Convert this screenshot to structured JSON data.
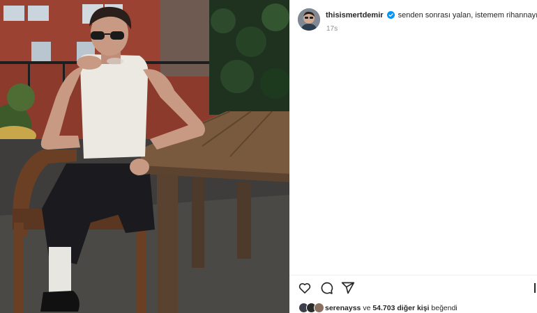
{
  "post": {
    "username": "thisismertdemir",
    "verified": true,
    "caption": "senden sonrası yalan, istemem rihannayı bile.",
    "time": "17s"
  },
  "actions": {
    "like_icon": "heart-icon",
    "comment_icon": "comment-icon",
    "share_icon": "share-icon"
  },
  "likes": {
    "first_liker": "serenayss",
    "connector": "ve",
    "others": "54.703 diğer kişi",
    "suffix": "beğendi"
  },
  "colors": {
    "verified_blue": "#0095f6",
    "text": "#262626",
    "muted": "#8e8e8e"
  }
}
